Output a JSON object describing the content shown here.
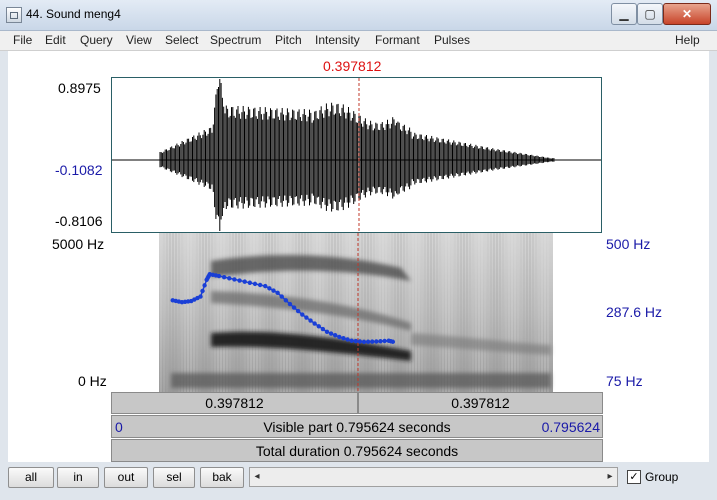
{
  "window": {
    "title": "44. Sound meng4",
    "minimize_icon": "minimize-icon",
    "maximize_icon": "maximize-icon",
    "close_icon": "close-icon"
  },
  "menu": {
    "items": [
      "File",
      "Edit",
      "Query",
      "View",
      "Select",
      "Spectrum",
      "Pitch",
      "Intensity",
      "Formant",
      "Pulses"
    ],
    "help": "Help"
  },
  "cursor": {
    "time": "0.397812"
  },
  "waveform": {
    "max": "0.8975",
    "cursor_value": "-0.1082",
    "min": "-0.8106"
  },
  "spectrogram": {
    "freq_top": "5000 Hz",
    "freq_bottom": "0 Hz"
  },
  "pitch_axis": {
    "top": "500 Hz",
    "mid": "287.6 Hz",
    "bottom": "75 Hz"
  },
  "pitch_contour": [
    [
      0.1,
      320
    ],
    [
      0.115,
      315
    ],
    [
      0.13,
      318
    ],
    [
      0.145,
      330
    ],
    [
      0.155,
      375
    ],
    [
      0.16,
      390
    ],
    [
      0.175,
      385
    ],
    [
      0.2,
      376
    ],
    [
      0.225,
      367
    ],
    [
      0.25,
      358
    ],
    [
      0.27,
      340
    ],
    [
      0.29,
      310
    ],
    [
      0.31,
      282
    ],
    [
      0.33,
      258
    ],
    [
      0.35,
      236
    ],
    [
      0.37,
      222
    ],
    [
      0.39,
      212
    ],
    [
      0.41,
      209
    ],
    [
      0.43,
      210
    ],
    [
      0.45,
      212
    ],
    [
      0.46,
      208
    ]
  ],
  "time_bars": {
    "left_segment": "0.397812",
    "right_segment": "0.397812"
  },
  "visible": {
    "start": "0",
    "label": "Visible part 0.795624 seconds",
    "end": "0.795624"
  },
  "total": {
    "label": "Total duration 0.795624 seconds"
  },
  "buttons": {
    "all": "all",
    "in": "in",
    "out": "out",
    "sel": "sel",
    "bak": "bak"
  },
  "scroll": {
    "left_arrow": "◂",
    "right_arrow": "▸"
  },
  "group": {
    "label": "Group",
    "checked": "✓"
  },
  "colors": {
    "cursor": "#dd1111",
    "pitch": "#1a3fd6",
    "axis_blue": "#1a1aa8"
  }
}
